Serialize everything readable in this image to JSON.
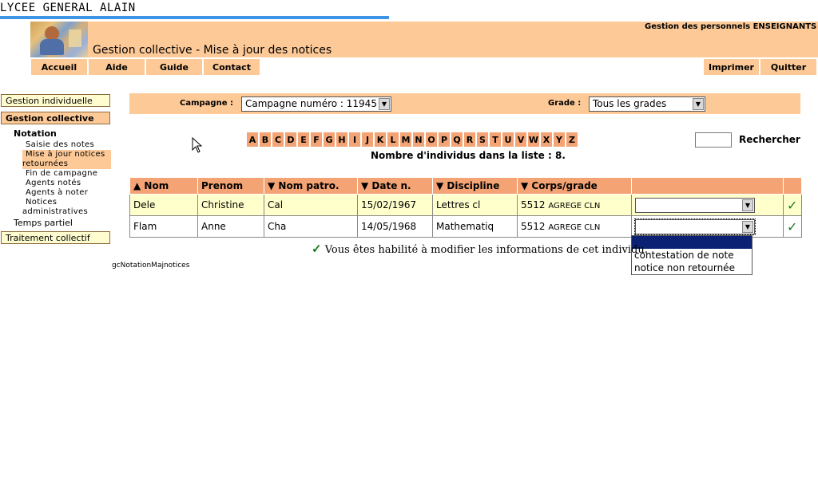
{
  "school": "LYCEE GENERAL ALAIN",
  "header": {
    "title": "Gestion collective - Mise à jour des notices",
    "right": "Gestion des personnels ENSEIGNANTS"
  },
  "topnav": {
    "home": "Accueil",
    "help": "Aide",
    "guide": "Guide",
    "contact": "Contact",
    "print": "Imprimer",
    "quit": "Quitter"
  },
  "sidebar": {
    "individual": "Gestion individuelle",
    "collective": "Gestion collective",
    "notation": "Notation",
    "links": [
      "Saisie des notes",
      "Mise à jour notices",
      "retournées",
      "Fin de campagne",
      "Agents notés",
      "Agents à noter",
      "Notices",
      "administratives"
    ],
    "part_time": "Temps partiel",
    "collective_processing": "Traitement collectif"
  },
  "filters": {
    "campaign_label": "Campagne :",
    "campaign_value": "Campagne numéro : 11945",
    "grade_label": "Grade :",
    "grade_value": "Tous les grades"
  },
  "alphabet": [
    "A",
    "B",
    "C",
    "D",
    "E",
    "F",
    "G",
    "H",
    "I",
    "J",
    "K",
    "L",
    "M",
    "N",
    "O",
    "P",
    "Q",
    "R",
    "S",
    "T",
    "U",
    "V",
    "W",
    "X",
    "Y",
    "Z"
  ],
  "search_label": "Rechercher",
  "count_text": "Nombre d'individus dans la liste : 8.",
  "table": {
    "headers": [
      "▲ Nom",
      "Prenom",
      "▼ Nom patro.",
      "▼ Date n.",
      "▼ Discipline",
      "▼ Corps/grade",
      "",
      ""
    ],
    "rows": [
      {
        "nom": "Dele",
        "prenom": "Christine",
        "patro": "Cal",
        "date": "15/02/1967",
        "discipline": "Lettres cl",
        "corps": "5512",
        "grade": "AGREGE CLN"
      },
      {
        "nom": "Flam",
        "prenom": "Anne",
        "patro": "Cha",
        "date": "14/05/1968",
        "discipline": "Mathematiq",
        "corps": "5512",
        "grade": "AGREGE CLN"
      }
    ]
  },
  "dropdown_options": [
    "contestation de note",
    "notice non retournée"
  ],
  "note": "Vous êtes habilité à modifier les informations de cet individu.",
  "footer_code": "gcNotationMajnotices",
  "colors": {
    "band": "#fdc997",
    "header_cell": "#f4a474",
    "highlight": "#ffffcc",
    "blue_line": "#3d95e6",
    "check": "#1a7a1a"
  }
}
